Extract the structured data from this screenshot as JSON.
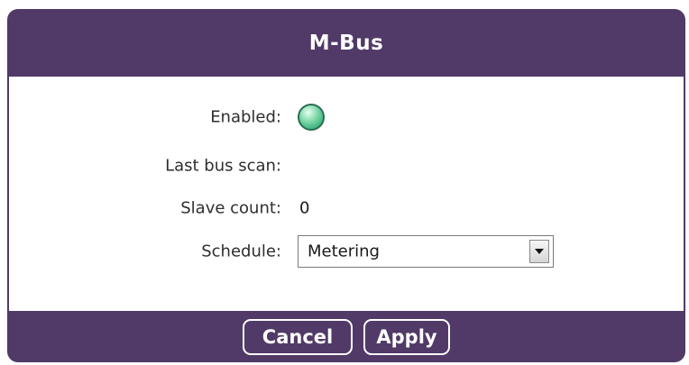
{
  "dialog": {
    "title": "M-Bus",
    "accent_color": "#513a67"
  },
  "fields": {
    "enabled": {
      "label": "Enabled:",
      "status_icon": "green-status-led"
    },
    "last_bus_scan": {
      "label": "Last bus scan:",
      "value": ""
    },
    "slave_count": {
      "label": "Slave count:",
      "value": "0"
    },
    "schedule": {
      "label": "Schedule:",
      "selected": "Metering",
      "icon": "dropdown-arrow-icon"
    }
  },
  "buttons": {
    "cancel": "Cancel",
    "apply": "Apply"
  }
}
